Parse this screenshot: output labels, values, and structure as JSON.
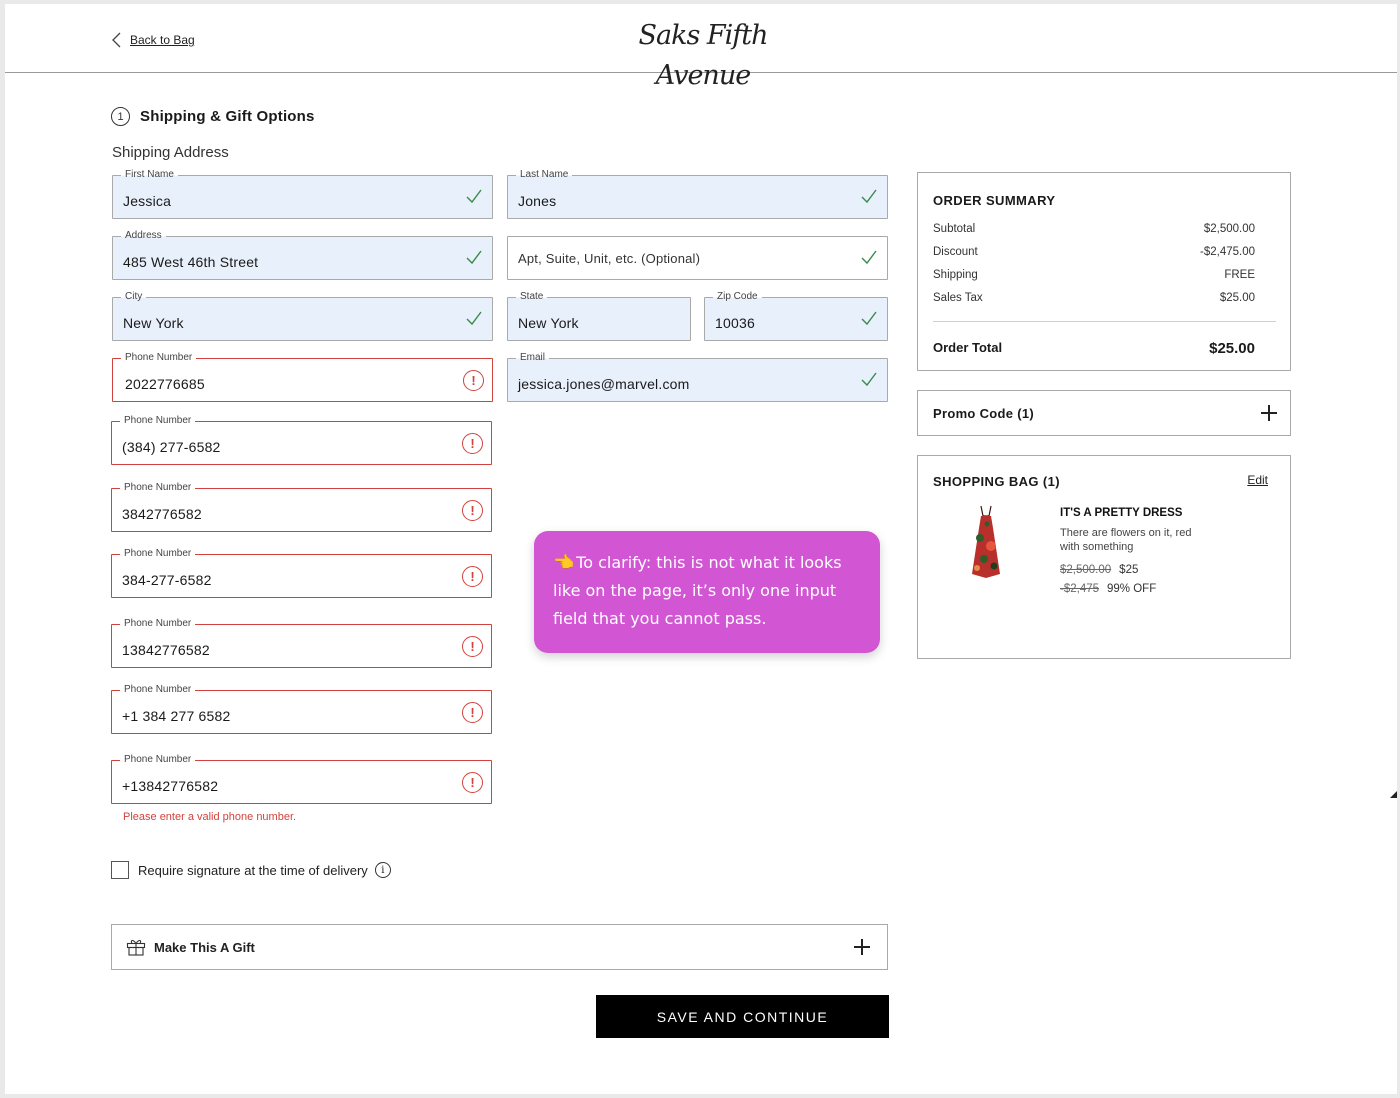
{
  "header": {
    "back_label": "Back to Bag",
    "logo_text": "Saks Fifth Avenue"
  },
  "section": {
    "step_number": "1",
    "title": "Shipping & Gift Options",
    "subtitle": "Shipping Address"
  },
  "form": {
    "first_name": {
      "label": "First Name",
      "value": "Jessica"
    },
    "last_name": {
      "label": "Last Name",
      "value": "Jones"
    },
    "address": {
      "label": "Address",
      "value": "485 West 46th Street"
    },
    "apt": {
      "placeholder": "Apt, Suite, Unit, etc. (Optional)"
    },
    "city": {
      "label": "City",
      "value": "New York"
    },
    "state": {
      "label": "State",
      "value": "New York"
    },
    "zip": {
      "label": "Zip Code",
      "value": "10036"
    },
    "email": {
      "label": "Email",
      "value": "jessica.jones@marvel.com"
    },
    "phone_label": "Phone Number",
    "phone_attempts": [
      "2022776685",
      "(384) 277-6582",
      "3842776582",
      "384-277-6582",
      "13842776582",
      "+1 384 277 6582",
      "+13842776582"
    ],
    "error_message": "Please enter a valid phone number.",
    "signature_label": "Require signature at the time of delivery",
    "gift_label": "Make This A Gift",
    "save_label": "SAVE AND CONTINUE"
  },
  "callout": {
    "emoji": "👈",
    "text": "To clarify: this is not what it looks like on the page, it’s only one input field that you cannot pass."
  },
  "order_summary": {
    "title": "ORDER SUMMARY",
    "rows": [
      {
        "label": "Subtotal",
        "value": "$2,500.00"
      },
      {
        "label": "Discount",
        "value": "-$2,475.00"
      },
      {
        "label": "Shipping",
        "value": "FREE"
      },
      {
        "label": "Sales Tax",
        "value": "$25.00"
      }
    ],
    "total_label": "Order Total",
    "total_value": "$25.00"
  },
  "promo": {
    "label": "Promo Code (1)"
  },
  "bag": {
    "title": "SHOPPING BAG (1)",
    "edit_label": "Edit",
    "item": {
      "name": "IT'S A PRETTY DRESS",
      "description": "There are flowers on it, red with something",
      "original_price": "$2,500.00",
      "price": "$25",
      "discount_amount": "-$2,475",
      "discount_pct": "99% OFF"
    }
  },
  "colors": {
    "autofill_bg": "#e8f0fc",
    "error_red": "#d0433d",
    "valid_green": "#3a8a4a",
    "callout_bg": "#d255d4",
    "button_bg": "#000000"
  }
}
